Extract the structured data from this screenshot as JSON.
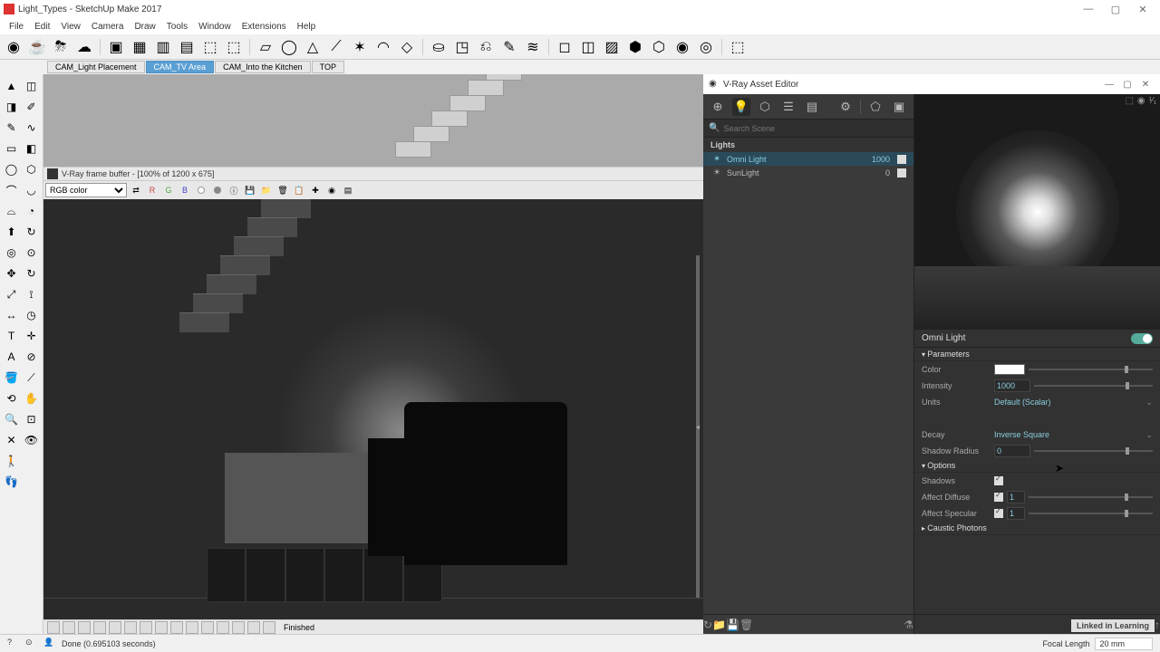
{
  "app": {
    "title": "Light_Types - SketchUp Make 2017"
  },
  "menu": [
    "File",
    "Edit",
    "View",
    "Camera",
    "Draw",
    "Tools",
    "Window",
    "Extensions",
    "Help"
  ],
  "scene_tabs": [
    {
      "label": "CAM_Light Placement",
      "active": false
    },
    {
      "label": "CAM_TV Area",
      "active": true
    },
    {
      "label": "CAM_Into the Kitchen",
      "active": false
    },
    {
      "label": "TOP",
      "active": false
    }
  ],
  "vfb": {
    "title": "V-Ray frame buffer - [100% of 1200 x 675]",
    "channel": "RGB color",
    "buttons": {
      "r": "R",
      "g": "G",
      "b": "B"
    },
    "status": "Finished"
  },
  "asset_editor": {
    "title": "V-Ray Asset Editor",
    "search_placeholder": "Search Scene",
    "lights_header": "Lights",
    "lights": [
      {
        "name": "Omni Light",
        "value": "1000",
        "active": true
      },
      {
        "name": "SunLight",
        "value": "0",
        "active": false
      }
    ],
    "selected": {
      "name": "Omni Light",
      "sections": {
        "parameters": "Parameters",
        "options": "Options",
        "caustic": "Caustic Photons"
      },
      "params": {
        "color_label": "Color",
        "intensity_label": "Intensity",
        "intensity": "1000",
        "units_label": "Units",
        "units": "Default (Scalar)",
        "decay_label": "Decay",
        "decay": "Inverse Square",
        "shadow_radius_label": "Shadow Radius",
        "shadow_radius": "0"
      },
      "options": {
        "shadows_label": "Shadows",
        "affect_diffuse_label": "Affect Diffuse",
        "affect_diffuse": "1",
        "affect_specular_label": "Affect Specular",
        "affect_specular": "1"
      }
    }
  },
  "status": {
    "message": "Done (0.695103 seconds)",
    "focal_label": "Focal Length",
    "focal_value": "20 mm"
  },
  "branding": "Linked in Learning"
}
